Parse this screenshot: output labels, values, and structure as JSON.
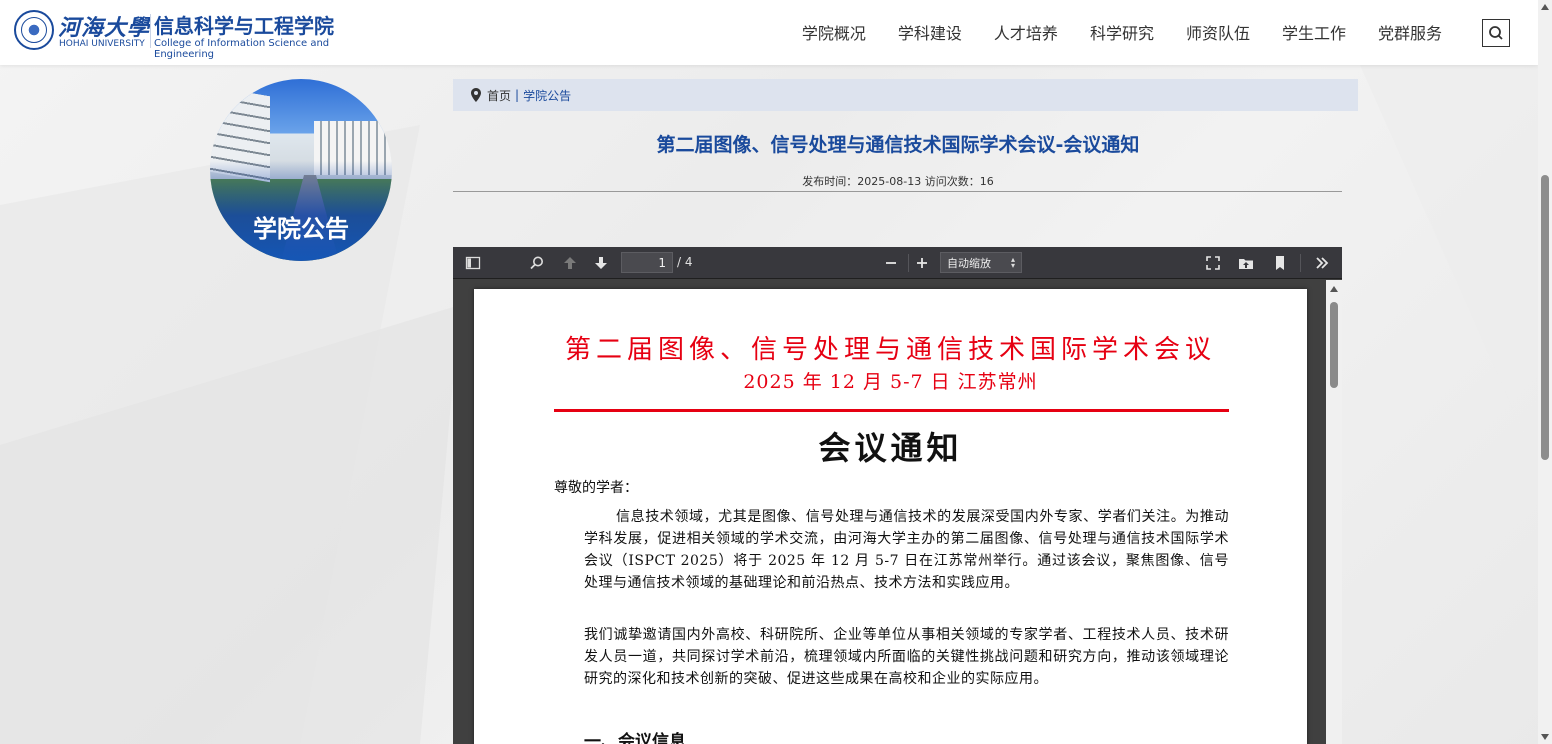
{
  "header": {
    "university_cn": "河海大學",
    "university_en": "HOHAI UNIVERSITY",
    "college_cn": "信息科学与工程学院",
    "college_en": "College of Information Science and Engineering",
    "nav": [
      "学院概况",
      "学科建设",
      "人才培养",
      "科学研究",
      "师资队伍",
      "学生工作",
      "党群服务"
    ],
    "search_icon": "search-icon"
  },
  "sidebar": {
    "badge_label": "学院公告"
  },
  "breadcrumb": {
    "home": "首页",
    "separator": "|",
    "current": "学院公告"
  },
  "article": {
    "title": "第二届图像、信号处理与通信技术国际学术会议-会议通知",
    "meta": "发布时间：2025-08-13 访问次数：16"
  },
  "pdf_viewer": {
    "page_current": "1",
    "page_total": "/ 4",
    "zoom": "自动缩放"
  },
  "pdf_content": {
    "heading": "第二届图像、信号处理与通信技术国际学术会议",
    "subheading": "2025 年 12 月 5-7 日   江苏常州",
    "title": "会议通知",
    "salutation": "尊敬的学者：",
    "para1": "信息技术领域，尤其是图像、信号处理与通信技术的发展深受国内外专家、学者们关注。为推动学科发展，促进相关领域的学术交流，由河海大学主办的第二届图像、信号处理与通信技术国际学术会议（ISPCT 2025）将于 2025 年 12 月 5-7 日在江苏常州举行。通过该会议，聚焦图像、信号处理与通信技术领域的基础理论和前沿热点、技术方法和实践应用。",
    "para2": "我们诚挚邀请国内外高校、科研院所、企业等单位从事相关领域的专家学者、工程技术人员、技术研发人员一道，共同探讨学术前沿，梳理领域内所面临的关键性挑战问题和研究方向，推动该领域理论研究的深化和技术创新的突破、促进这些成果在高校和企业的实际应用。",
    "section1": "一、会议信息"
  },
  "colors": {
    "brand_blue": "#1a4a9c",
    "pdf_red": "#e60012",
    "toolbar": "#38383d"
  }
}
